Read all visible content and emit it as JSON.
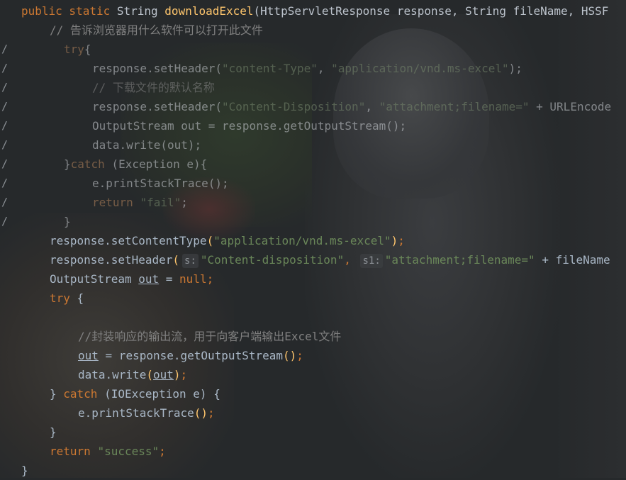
{
  "editor": {
    "lines": [
      {
        "gutter": "",
        "indent": 30,
        "dim": false,
        "tokens": [
          {
            "c": "kw",
            "t": "public static "
          },
          {
            "c": "pl",
            "t": "String "
          },
          {
            "c": "fn",
            "t": "downloadExcel"
          },
          {
            "c": "pl",
            "t": "(HttpServletResponse response, String fileName, HSSF"
          }
        ]
      },
      {
        "gutter": "",
        "indent": 70,
        "dim": false,
        "tokens": [
          {
            "c": "cm",
            "t": "// 告诉浏览器用什么软件可以打开此文件"
          }
        ]
      },
      {
        "gutter": "/",
        "indent": 90,
        "dim": true,
        "tokens": [
          {
            "c": "kw",
            "t": "try"
          },
          {
            "c": "pl",
            "t": "{"
          }
        ]
      },
      {
        "gutter": "/",
        "indent": 130,
        "dim": true,
        "tokens": [
          {
            "c": "pl",
            "t": "response.setHeader("
          },
          {
            "c": "st",
            "t": "\"content-Type\""
          },
          {
            "c": "pl",
            "t": ", "
          },
          {
            "c": "st",
            "t": "\"application/vnd.ms-excel\""
          },
          {
            "c": "pl",
            "t": ");"
          }
        ]
      },
      {
        "gutter": "/",
        "indent": 130,
        "dim": true,
        "tokens": [
          {
            "c": "cm",
            "t": "// 下载文件的默认名称"
          }
        ]
      },
      {
        "gutter": "/",
        "indent": 130,
        "dim": true,
        "tokens": [
          {
            "c": "pl",
            "t": "response.setHeader("
          },
          {
            "c": "st",
            "t": "\"Content-Disposition\""
          },
          {
            "c": "pl",
            "t": ", "
          },
          {
            "c": "st",
            "t": "\"attachment;filename=\""
          },
          {
            "c": "pl",
            "t": " + URLEncode"
          }
        ]
      },
      {
        "gutter": "/",
        "indent": 130,
        "dim": true,
        "tokens": [
          {
            "c": "pl",
            "t": "OutputStream out = response.getOutputStream();"
          }
        ]
      },
      {
        "gutter": "/",
        "indent": 130,
        "dim": true,
        "tokens": [
          {
            "c": "pl",
            "t": "data.write(out);"
          }
        ]
      },
      {
        "gutter": "/",
        "indent": 90,
        "dim": true,
        "tokens": [
          {
            "c": "pl",
            "t": "}"
          },
          {
            "c": "kw",
            "t": "catch "
          },
          {
            "c": "pl",
            "t": "(Exception e){"
          }
        ]
      },
      {
        "gutter": "/",
        "indent": 130,
        "dim": true,
        "tokens": [
          {
            "c": "pl",
            "t": "e.printStackTrace();"
          }
        ]
      },
      {
        "gutter": "/",
        "indent": 130,
        "dim": true,
        "tokens": [
          {
            "c": "kw",
            "t": "return "
          },
          {
            "c": "st",
            "t": "\"fail\""
          },
          {
            "c": "pl",
            "t": ";"
          }
        ]
      },
      {
        "gutter": "/",
        "indent": 90,
        "dim": true,
        "tokens": [
          {
            "c": "pl",
            "t": "}"
          }
        ]
      },
      {
        "gutter": "",
        "indent": 70,
        "dim": false,
        "tokens": [
          {
            "c": "mt",
            "t": "response."
          },
          {
            "c": "mt",
            "t": "setContentType"
          },
          {
            "c": "fn",
            "t": "("
          },
          {
            "c": "st",
            "t": "\"application/vnd.ms-excel\""
          },
          {
            "c": "fn",
            "t": ")"
          },
          {
            "c": "kw",
            "t": ";"
          }
        ]
      },
      {
        "gutter": "",
        "indent": 70,
        "dim": false,
        "tokens": [
          {
            "c": "mt",
            "t": "response."
          },
          {
            "c": "mt",
            "t": "setHeader"
          },
          {
            "c": "fn",
            "t": "("
          },
          {
            "c": "hint",
            "t": "s:"
          },
          {
            "c": "st",
            "t": "\"Content-disposition\""
          },
          {
            "c": "kw",
            "t": ", "
          },
          {
            "c": "hint",
            "t": "s1:"
          },
          {
            "c": "st",
            "t": "\"attachment;filename=\""
          },
          {
            "c": "mt",
            "t": " + fileName"
          }
        ]
      },
      {
        "gutter": "",
        "indent": 70,
        "dim": false,
        "tokens": [
          {
            "c": "mt",
            "t": "OutputStream "
          },
          {
            "c": "ul",
            "t": "out"
          },
          {
            "c": "mt",
            "t": " = "
          },
          {
            "c": "kw",
            "t": "null"
          },
          {
            "c": "kw",
            "t": ";"
          }
        ]
      },
      {
        "gutter": "",
        "indent": 70,
        "dim": false,
        "tokens": [
          {
            "c": "kw",
            "t": "try "
          },
          {
            "c": "mt",
            "t": "{"
          }
        ]
      },
      {
        "gutter": "",
        "indent": 70,
        "dim": false,
        "tokens": []
      },
      {
        "gutter": "",
        "indent": 110,
        "dim": false,
        "tokens": [
          {
            "c": "cm",
            "t": "//封装响应的输出流，用于向客户端输出Excel文件"
          }
        ]
      },
      {
        "gutter": "",
        "indent": 110,
        "dim": false,
        "tokens": [
          {
            "c": "ul",
            "t": "out"
          },
          {
            "c": "mt",
            "t": " = response.getOutputStream"
          },
          {
            "c": "fn",
            "t": "()"
          },
          {
            "c": "kw",
            "t": ";"
          }
        ]
      },
      {
        "gutter": "",
        "indent": 110,
        "dim": false,
        "tokens": [
          {
            "c": "mt",
            "t": "data.write"
          },
          {
            "c": "fn",
            "t": "("
          },
          {
            "c": "ul",
            "t": "out"
          },
          {
            "c": "fn",
            "t": ")"
          },
          {
            "c": "kw",
            "t": ";"
          }
        ]
      },
      {
        "gutter": "",
        "indent": 70,
        "dim": false,
        "tokens": [
          {
            "c": "mt",
            "t": "} "
          },
          {
            "c": "kw",
            "t": "catch "
          },
          {
            "c": "mt",
            "t": "(IOException e) {"
          }
        ]
      },
      {
        "gutter": "",
        "indent": 110,
        "dim": false,
        "tokens": [
          {
            "c": "mt",
            "t": "e.printStackTrace"
          },
          {
            "c": "fn",
            "t": "()"
          },
          {
            "c": "kw",
            "t": ";"
          }
        ]
      },
      {
        "gutter": "",
        "indent": 70,
        "dim": false,
        "tokens": [
          {
            "c": "mt",
            "t": "}"
          }
        ]
      },
      {
        "gutter": "",
        "indent": 70,
        "dim": false,
        "tokens": [
          {
            "c": "kw",
            "t": "return "
          },
          {
            "c": "st",
            "t": "\"success\""
          },
          {
            "c": "kw",
            "t": ";"
          }
        ]
      },
      {
        "gutter": "",
        "indent": 30,
        "dim": false,
        "tokens": [
          {
            "c": "mt",
            "t": "}"
          }
        ]
      }
    ]
  },
  "colors": {
    "keyword": "#cc7832",
    "string": "#6a8759",
    "comment": "#808080",
    "function": "#ffc66d",
    "plain": "#a9b7c6",
    "background": "#26292b"
  }
}
